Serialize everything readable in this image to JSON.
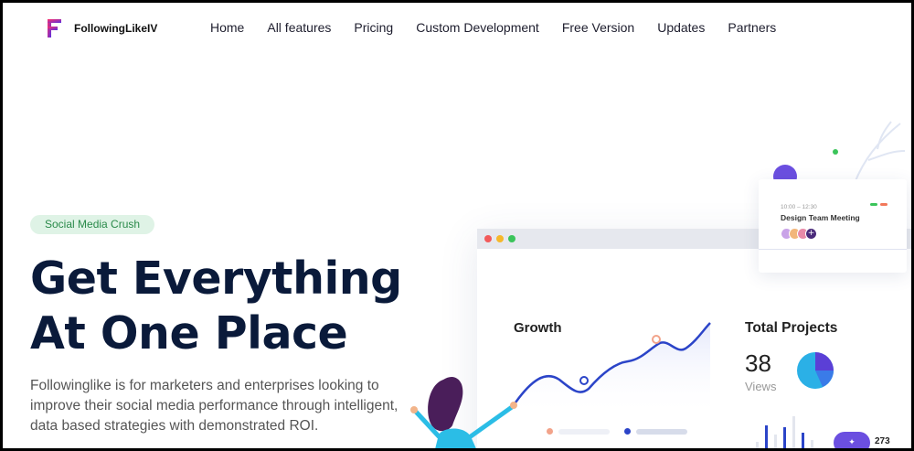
{
  "brand": {
    "name": "FollowingLikeIV"
  },
  "nav": {
    "items": [
      {
        "label": "Home"
      },
      {
        "label": "All features"
      },
      {
        "label": "Pricing"
      },
      {
        "label": "Custom Development"
      },
      {
        "label": "Free Version"
      },
      {
        "label": "Updates"
      },
      {
        "label": "Partners"
      }
    ]
  },
  "hero": {
    "tag": "Social Media Crush",
    "title_line1": "Get Everything",
    "title_line2": "At One Place",
    "description": "Followinglike is for marketers and enterprises looking to improve their social media performance through intelligent, data based strategies with demonstrated ROI."
  },
  "illustration": {
    "growth_label": "Growth",
    "total_label": "Total Projects",
    "views_value": "38",
    "views_label": "Views",
    "meeting_time": "10:00 – 12:30",
    "meeting_title": "Design Team Meeting",
    "count": "273"
  },
  "colors": {
    "accent": "#6b4fe0",
    "navy": "#0a1a3a",
    "tag_bg": "#dff3e6",
    "tag_text": "#2a8a4a",
    "chart_line": "#2b44c8"
  }
}
